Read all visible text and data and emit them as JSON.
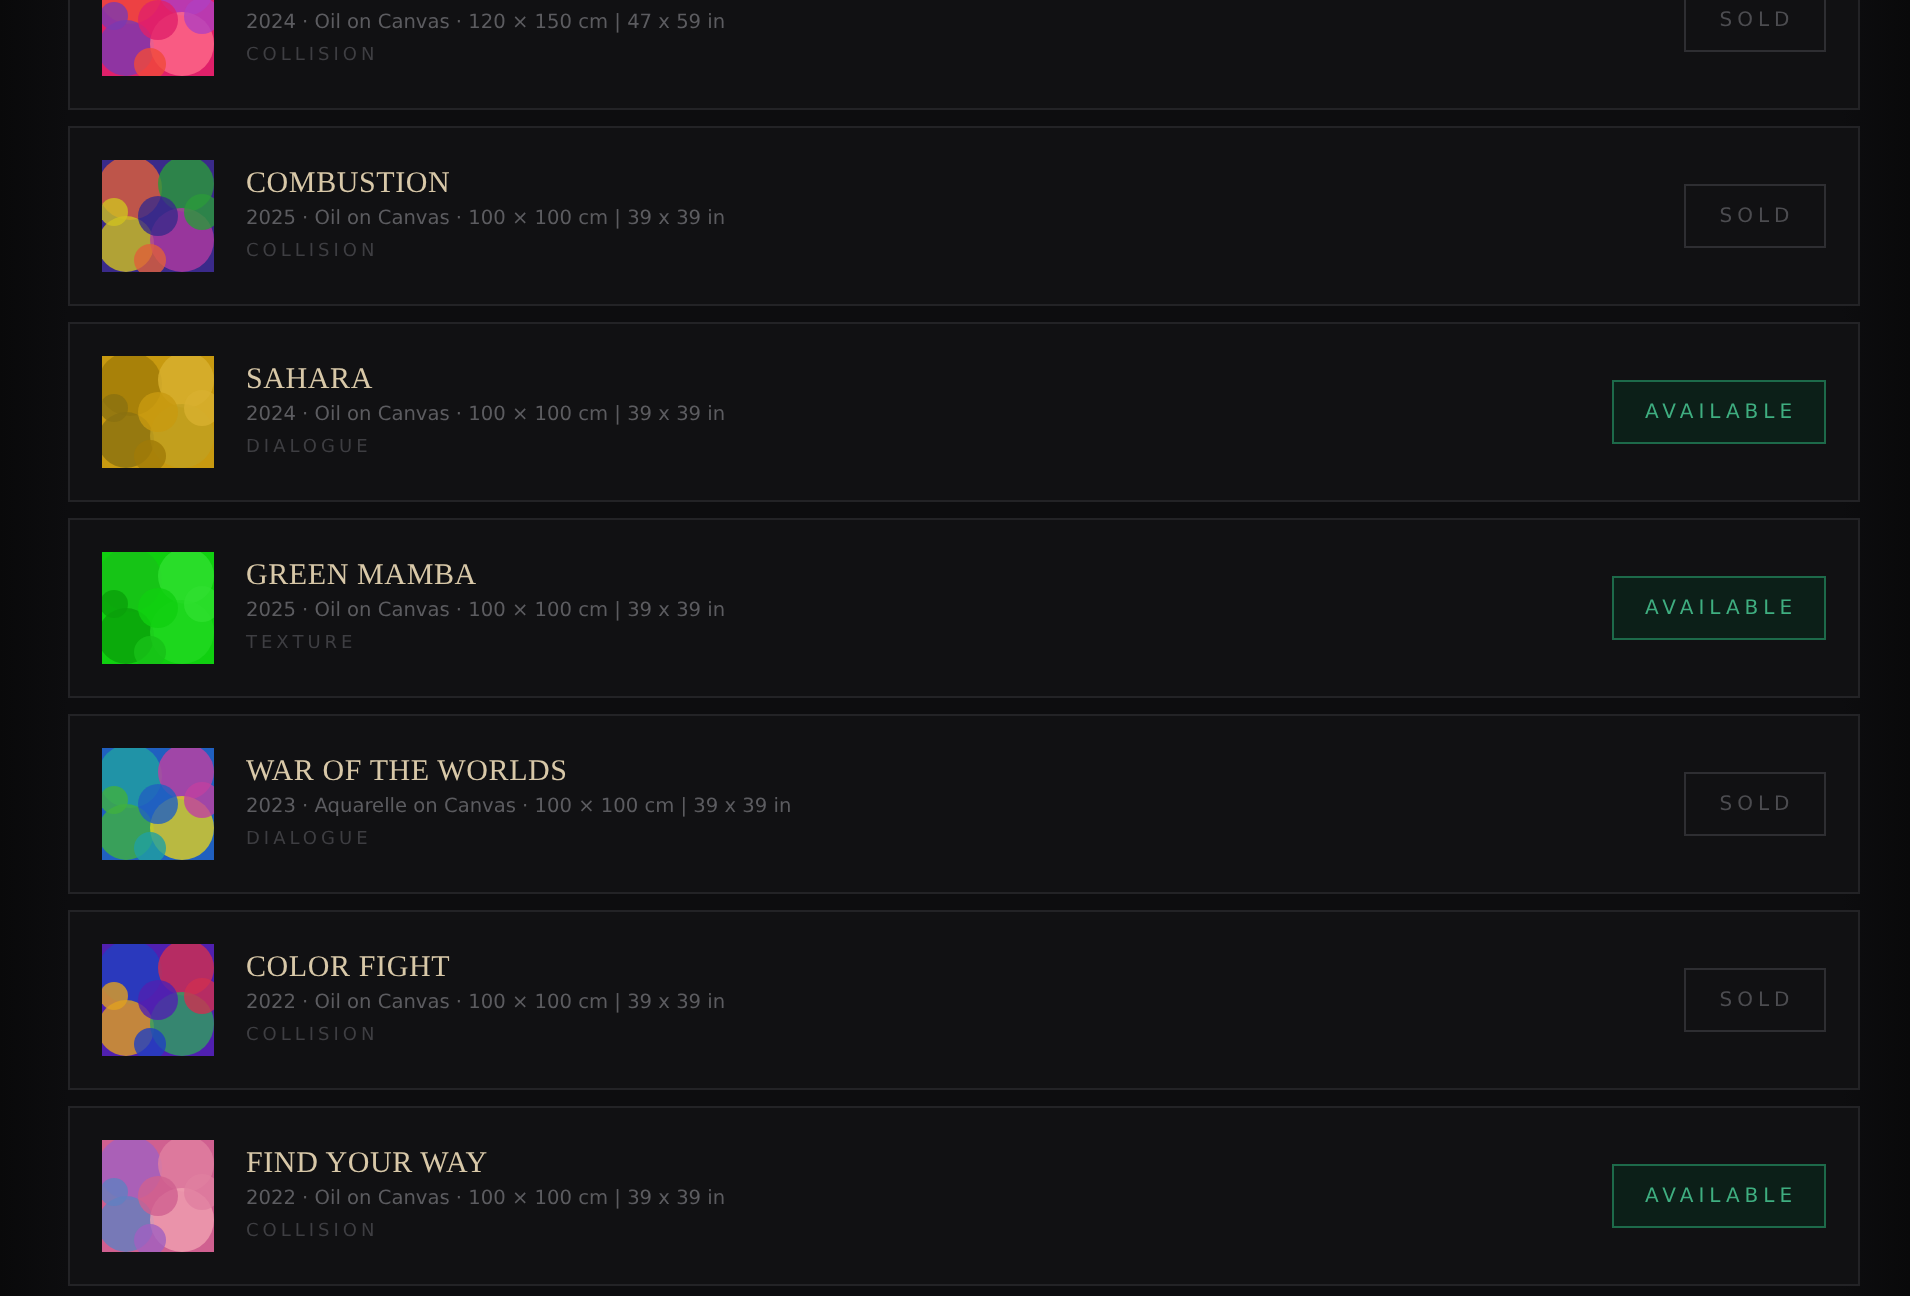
{
  "artworks": [
    {
      "meta": "2024 · Oil on Canvas · 120 × 150 cm | 47 x 59 in",
      "series": "COLLISION",
      "status": {
        "kind": "sold",
        "label": "SOLD"
      }
    },
    {
      "title": "COMBUSTION",
      "meta": "2025 · Oil on Canvas · 100 × 100 cm | 39 x 39 in",
      "series": "COLLISION",
      "status": {
        "kind": "sold",
        "label": "SOLD"
      }
    },
    {
      "title": "SAHARA",
      "meta": "2024 · Oil on Canvas · 100 × 100 cm | 39 x 39 in",
      "series": "DIALOGUE",
      "status": {
        "kind": "available",
        "label": "AVAILABLE"
      }
    },
    {
      "title": "GREEN MAMBA",
      "meta": "2025 · Oil on Canvas · 100 × 100 cm | 39 x 39 in",
      "series": "TEXTURE",
      "status": {
        "kind": "available",
        "label": "AVAILABLE"
      }
    },
    {
      "title": "WAR OF THE WORLDS",
      "meta": "2023 · Aquarelle on Canvas · 100 × 100 cm | 39 x 39 in",
      "series": "DIALOGUE",
      "status": {
        "kind": "sold",
        "label": "SOLD"
      }
    },
    {
      "title": "COLOR FIGHT",
      "meta": "2022 · Oil on Canvas · 100 × 100 cm | 39 x 39 in",
      "series": "COLLISION",
      "status": {
        "kind": "sold",
        "label": "SOLD"
      }
    },
    {
      "title": "FIND YOUR WAY",
      "meta": "2022 · Oil on Canvas · 100 × 100 cm | 39 x 39 in",
      "series": "COLLISION",
      "status": {
        "kind": "available",
        "label": "AVAILABLE"
      }
    }
  ]
}
